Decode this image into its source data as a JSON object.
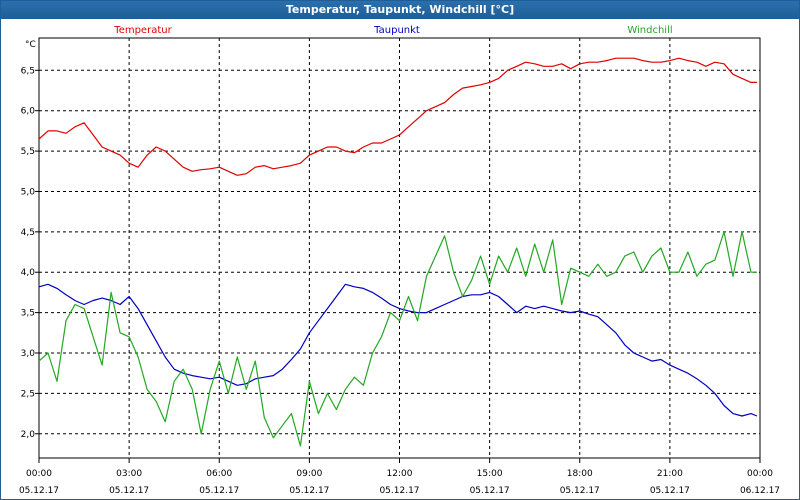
{
  "window": {
    "title": "Temperatur, Taupunkt, Windchill [°C]"
  },
  "colors": {
    "title_bg": "#1f5e96",
    "temperature": "#e00000",
    "dewpoint": "#0000c0",
    "windchill": "#22a822",
    "grid": "#000000"
  },
  "chart_data": {
    "type": "line",
    "title": "Temperatur, Taupunkt, Windchill [°C]",
    "ylabel": "°C",
    "ylim": [
      1.7,
      6.9
    ],
    "yticks": [
      "2,0",
      "2,5",
      "3,0",
      "3,5",
      "4,0",
      "4,5",
      "5,0",
      "5,5",
      "6,0",
      "6,5"
    ],
    "ytick_values": [
      2.0,
      2.5,
      3.0,
      3.5,
      4.0,
      4.5,
      5.0,
      5.5,
      6.0,
      6.5
    ],
    "x_hours": [
      0,
      24
    ],
    "xticks": [
      {
        "time": "00:00",
        "date": "05.12.17"
      },
      {
        "time": "03:00",
        "date": "05.12.17"
      },
      {
        "time": "06:00",
        "date": "05.12.17"
      },
      {
        "time": "09:00",
        "date": "05.12.17"
      },
      {
        "time": "12:00",
        "date": "05.12.17"
      },
      {
        "time": "15:00",
        "date": "05.12.17"
      },
      {
        "time": "18:00",
        "date": "05.12.17"
      },
      {
        "time": "21:00",
        "date": "05.12.17"
      },
      {
        "time": "00:00",
        "date": "06.12.17"
      }
    ],
    "grid": true,
    "series": [
      {
        "name": "Temperatur",
        "color": "#e00000",
        "x": [
          0.0,
          0.3,
          0.6,
          0.9,
          1.2,
          1.5,
          1.8,
          2.1,
          2.4,
          2.7,
          3.0,
          3.3,
          3.6,
          3.9,
          4.2,
          4.5,
          4.8,
          5.1,
          5.4,
          5.7,
          6.0,
          6.3,
          6.6,
          6.9,
          7.2,
          7.5,
          7.8,
          8.1,
          8.4,
          8.7,
          9.0,
          9.3,
          9.6,
          9.9,
          10.2,
          10.5,
          10.8,
          11.1,
          11.4,
          11.7,
          12.0,
          12.3,
          12.6,
          12.9,
          13.2,
          13.5,
          13.8,
          14.1,
          14.4,
          14.7,
          15.0,
          15.3,
          15.6,
          15.9,
          16.2,
          16.5,
          16.8,
          17.1,
          17.4,
          17.7,
          18.0,
          18.3,
          18.6,
          18.9,
          19.2,
          19.5,
          19.8,
          20.1,
          20.4,
          20.7,
          21.0,
          21.3,
          21.6,
          21.9,
          22.2,
          22.5,
          22.8,
          23.1,
          23.4,
          23.7,
          23.9
        ],
        "y": [
          5.65,
          5.75,
          5.75,
          5.72,
          5.8,
          5.85,
          5.7,
          5.55,
          5.5,
          5.45,
          5.35,
          5.3,
          5.45,
          5.55,
          5.5,
          5.4,
          5.3,
          5.25,
          5.27,
          5.28,
          5.3,
          5.25,
          5.2,
          5.22,
          5.3,
          5.32,
          5.28,
          5.3,
          5.32,
          5.35,
          5.45,
          5.5,
          5.55,
          5.55,
          5.5,
          5.48,
          5.55,
          5.6,
          5.6,
          5.65,
          5.7,
          5.8,
          5.9,
          6.0,
          6.05,
          6.1,
          6.2,
          6.28,
          6.3,
          6.32,
          6.35,
          6.4,
          6.5,
          6.55,
          6.6,
          6.58,
          6.55,
          6.55,
          6.58,
          6.52,
          6.58,
          6.6,
          6.6,
          6.62,
          6.65,
          6.65,
          6.65,
          6.62,
          6.6,
          6.6,
          6.62,
          6.65,
          6.62,
          6.6,
          6.55,
          6.6,
          6.58,
          6.45,
          6.4,
          6.35,
          6.35
        ]
      },
      {
        "name": "Taupunkt",
        "color": "#0000c0",
        "x": [
          0.0,
          0.3,
          0.6,
          0.9,
          1.2,
          1.5,
          1.8,
          2.1,
          2.4,
          2.7,
          3.0,
          3.3,
          3.6,
          3.9,
          4.2,
          4.5,
          4.8,
          5.1,
          5.4,
          5.7,
          6.0,
          6.3,
          6.6,
          6.9,
          7.2,
          7.5,
          7.8,
          8.1,
          8.4,
          8.7,
          9.0,
          9.3,
          9.6,
          9.9,
          10.2,
          10.5,
          10.8,
          11.1,
          11.4,
          11.7,
          12.0,
          12.3,
          12.6,
          12.9,
          13.2,
          13.5,
          13.8,
          14.1,
          14.4,
          14.7,
          15.0,
          15.3,
          15.6,
          15.9,
          16.2,
          16.5,
          16.8,
          17.1,
          17.4,
          17.7,
          18.0,
          18.3,
          18.6,
          18.9,
          19.2,
          19.5,
          19.8,
          20.1,
          20.4,
          20.7,
          21.0,
          21.3,
          21.6,
          21.9,
          22.2,
          22.5,
          22.8,
          23.1,
          23.4,
          23.7,
          23.9
        ],
        "y": [
          3.82,
          3.85,
          3.8,
          3.72,
          3.65,
          3.6,
          3.65,
          3.68,
          3.65,
          3.6,
          3.7,
          3.55,
          3.35,
          3.15,
          2.95,
          2.8,
          2.75,
          2.72,
          2.7,
          2.68,
          2.7,
          2.65,
          2.6,
          2.62,
          2.68,
          2.7,
          2.72,
          2.8,
          2.92,
          3.05,
          3.25,
          3.4,
          3.55,
          3.7,
          3.85,
          3.82,
          3.8,
          3.75,
          3.68,
          3.6,
          3.55,
          3.52,
          3.5,
          3.5,
          3.55,
          3.6,
          3.65,
          3.7,
          3.72,
          3.72,
          3.75,
          3.7,
          3.6,
          3.5,
          3.58,
          3.55,
          3.58,
          3.55,
          3.52,
          3.5,
          3.52,
          3.48,
          3.45,
          3.35,
          3.25,
          3.1,
          3.0,
          2.95,
          2.9,
          2.92,
          2.85,
          2.8,
          2.75,
          2.68,
          2.6,
          2.5,
          2.35,
          2.25,
          2.22,
          2.25,
          2.22
        ]
      },
      {
        "name": "Windchill",
        "color": "#22a822",
        "x": [
          0.0,
          0.3,
          0.6,
          0.9,
          1.2,
          1.5,
          1.8,
          2.1,
          2.4,
          2.7,
          3.0,
          3.3,
          3.6,
          3.9,
          4.2,
          4.5,
          4.8,
          5.1,
          5.4,
          5.7,
          6.0,
          6.3,
          6.6,
          6.9,
          7.2,
          7.5,
          7.8,
          8.1,
          8.4,
          8.7,
          9.0,
          9.3,
          9.6,
          9.9,
          10.2,
          10.5,
          10.8,
          11.1,
          11.4,
          11.7,
          12.0,
          12.3,
          12.6,
          12.9,
          13.2,
          13.5,
          13.8,
          14.1,
          14.4,
          14.7,
          15.0,
          15.3,
          15.6,
          15.9,
          16.2,
          16.5,
          16.8,
          17.1,
          17.4,
          17.7,
          18.0,
          18.3,
          18.6,
          18.9,
          19.2,
          19.5,
          19.8,
          20.1,
          20.4,
          20.7,
          21.0,
          21.3,
          21.6,
          21.9,
          22.2,
          22.5,
          22.8,
          23.1,
          23.4,
          23.7,
          23.9
        ],
        "y": [
          2.9,
          3.0,
          2.65,
          3.4,
          3.6,
          3.55,
          3.2,
          2.85,
          3.75,
          3.25,
          3.2,
          2.95,
          2.55,
          2.4,
          2.15,
          2.65,
          2.8,
          2.55,
          2.0,
          2.55,
          2.9,
          2.5,
          2.95,
          2.55,
          2.9,
          2.2,
          1.95,
          2.1,
          2.25,
          1.85,
          2.65,
          2.25,
          2.5,
          2.3,
          2.55,
          2.7,
          2.6,
          3.0,
          3.2,
          3.5,
          3.4,
          3.7,
          3.4,
          3.95,
          4.2,
          4.45,
          4.0,
          3.7,
          3.9,
          4.2,
          3.85,
          4.2,
          4.0,
          4.3,
          3.95,
          4.35,
          4.0,
          4.4,
          3.6,
          4.05,
          4.0,
          3.95,
          4.1,
          3.95,
          4.0,
          4.2,
          4.25,
          4.0,
          4.2,
          4.3,
          4.0,
          4.0,
          4.25,
          3.95,
          4.1,
          4.15,
          4.5,
          3.95,
          4.5,
          4.0,
          4.0
        ]
      }
    ]
  }
}
